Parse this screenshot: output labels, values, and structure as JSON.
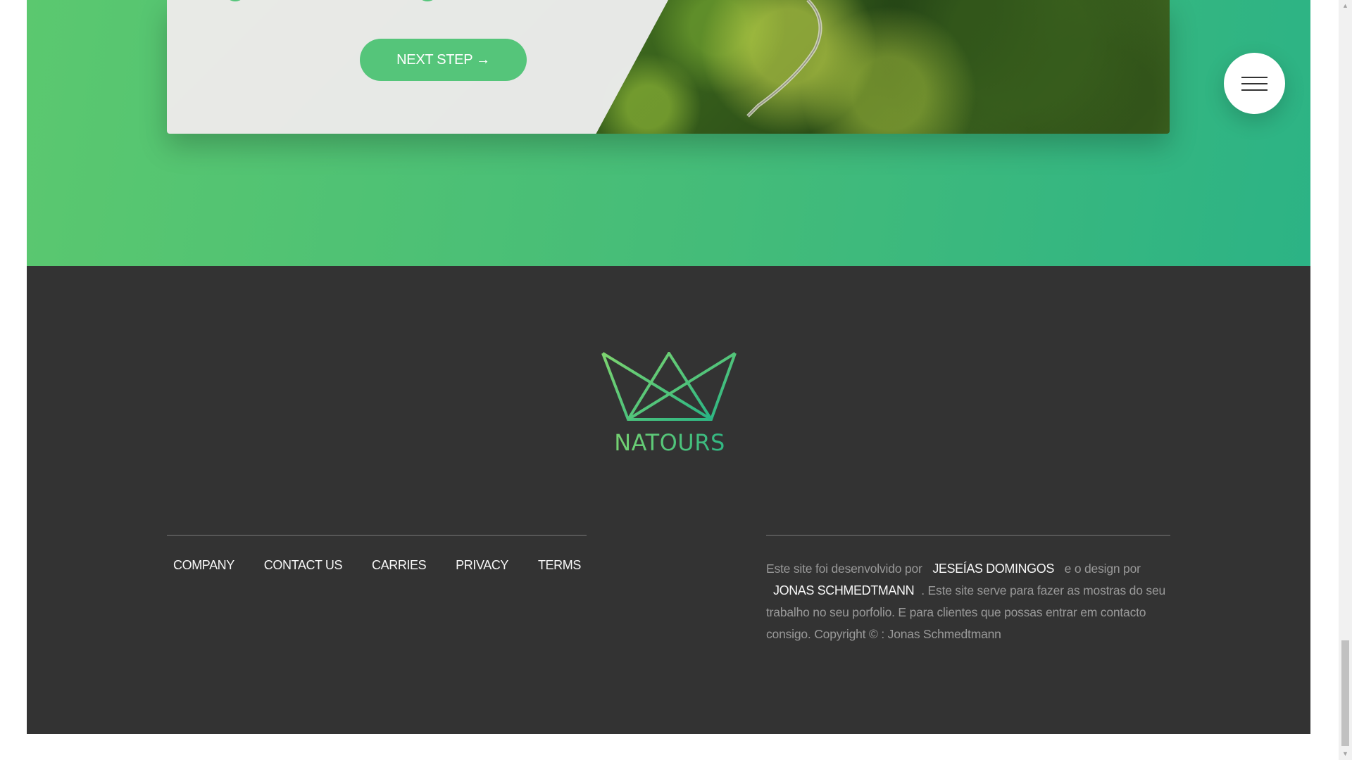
{
  "booking": {
    "next_button_label": "NEXT STEP →"
  },
  "footer": {
    "logo_text": "NATOURS",
    "nav": [
      {
        "label": "COMPANY"
      },
      {
        "label": "CONTACT US"
      },
      {
        "label": "CARRIES"
      },
      {
        "label": "PRIVACY"
      },
      {
        "label": "TERMS"
      }
    ],
    "credits": {
      "part1": "Este site foi desenvolvido por",
      "developer": "JESEÍAS DOMINGOS",
      "part2": "e o design por",
      "designer": "JONAS SCHMEDTMANN",
      "part3": ". Este site serve para fazer as mostras do seu trabalho no seu porfolio. E para clientes que possas entrar em contacto consigo. Copyright © : Jonas Schmedtmann"
    }
  },
  "icons": {
    "menu": "hamburger-menu-icon",
    "logo": "crown-logo-icon",
    "scroll_up": "chevron-up-icon",
    "scroll_down": "chevron-down-icon"
  },
  "colors": {
    "primary_green": "#55c57a",
    "gradient_light": "#7ed56f",
    "gradient_dark": "#28b485",
    "footer_bg": "#333333",
    "footer_text": "#999999",
    "link_text": "#f7f7f7"
  }
}
